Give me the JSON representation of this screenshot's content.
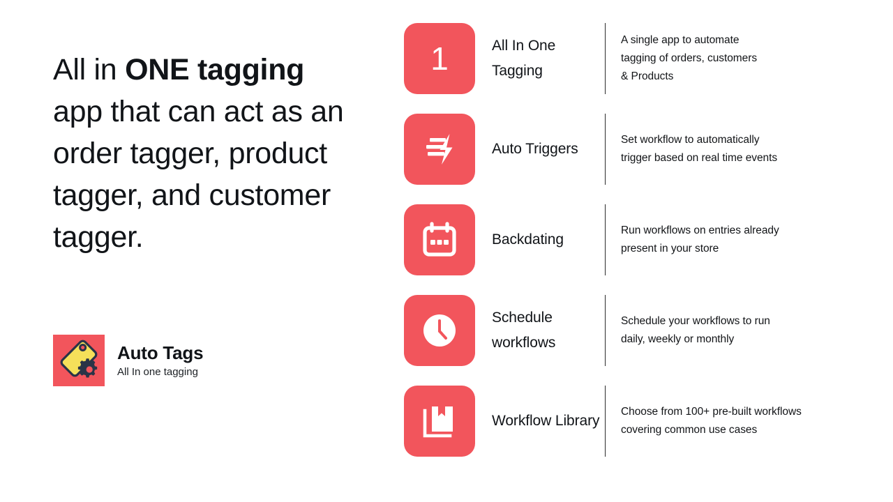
{
  "brand": {
    "accent_color": "#F2555C",
    "logo_tag_color": "#F5E05A",
    "logo_outline_color": "#2A3447",
    "text_color": "#111418"
  },
  "headline": {
    "part_1": "All in ",
    "part_2_bold": "ONE tagging",
    "rest": " app that can act as an order tagger, product tagger, and customer tagger."
  },
  "logo": {
    "icon": "price-tag-gear-icon",
    "title": "Auto Tags",
    "subtitle": "All In one tagging"
  },
  "features": [
    {
      "icon": "number-one-icon",
      "badge": "1",
      "title": "All In One Tagging",
      "description_lines": [
        "A single app to automate",
        "tagging of orders, customers",
        "& Products"
      ]
    },
    {
      "icon": "lightning-bars-icon",
      "badge": "",
      "title": "Auto Triggers",
      "description_lines": [
        "Set workflow to automatically",
        "trigger based on real time events"
      ]
    },
    {
      "icon": "calendar-icon",
      "badge": "",
      "title": "Backdating",
      "description_lines": [
        "Run workflows on entries already",
        "present in your store"
      ]
    },
    {
      "icon": "clock-icon",
      "badge": "",
      "title": "Schedule workflows",
      "description_lines": [
        "Schedule your workflows to run",
        "daily, weekly or monthly"
      ]
    },
    {
      "icon": "book-library-icon",
      "badge": "",
      "title": "Workflow Library",
      "description_lines": [
        "Choose from 100+ pre-built workflows",
        "covering common use cases"
      ]
    }
  ]
}
